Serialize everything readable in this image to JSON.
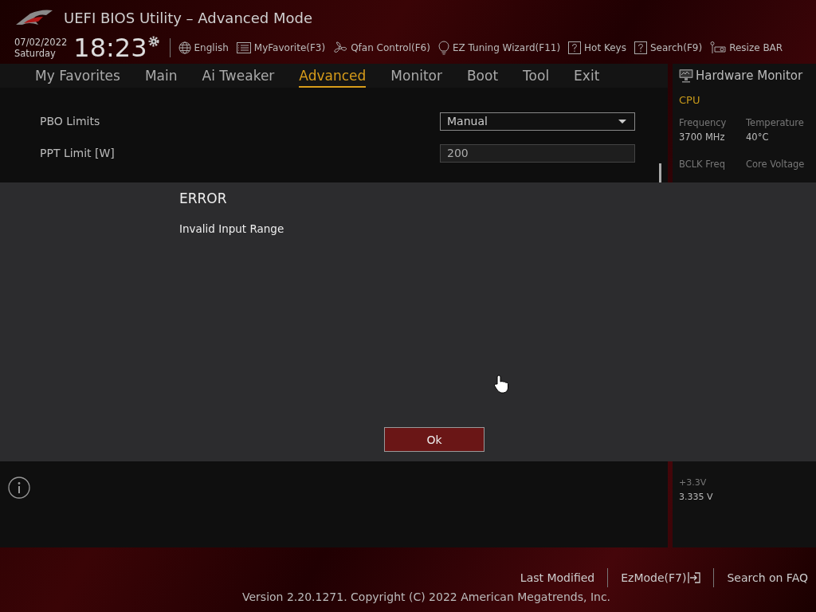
{
  "window": {
    "title": "UEFI BIOS Utility – Advanced Mode"
  },
  "clock": {
    "date": "07/02/2022",
    "day": "Saturday",
    "time": "18:23"
  },
  "toolbar": [
    {
      "label": "English",
      "kind": "globe"
    },
    {
      "label": "MyFavorite(F3)",
      "kind": "list"
    },
    {
      "label": "Qfan Control(F6)",
      "kind": "fan"
    },
    {
      "label": "EZ Tuning Wizard(F11)",
      "kind": "bulb"
    },
    {
      "label": "Hot Keys",
      "kind": "help"
    },
    {
      "label": "Search(F9)",
      "kind": "help"
    },
    {
      "label": "Resize BAR",
      "kind": "card"
    }
  ],
  "tabs": [
    {
      "label": "My Favorites",
      "selected": false
    },
    {
      "label": "Main",
      "selected": false
    },
    {
      "label": "Ai Tweaker",
      "selected": false
    },
    {
      "label": "Advanced",
      "selected": true
    },
    {
      "label": "Monitor",
      "selected": false
    },
    {
      "label": "Boot",
      "selected": false
    },
    {
      "label": "Tool",
      "selected": false
    },
    {
      "label": "Exit",
      "selected": false
    }
  ],
  "settings": [
    {
      "label": "PBO Limits",
      "kind": "dropdown",
      "value": "Manual"
    },
    {
      "label": "PPT Limit [W]",
      "kind": "input",
      "value": "200"
    }
  ],
  "hardware_monitor": {
    "title": "Hardware Monitor",
    "section": "CPU",
    "readings": [
      {
        "label": "Frequency",
        "value": "3700 MHz"
      },
      {
        "label": "Temperature",
        "value": "40°C"
      },
      {
        "label": "BCLK Freq"
      },
      {
        "label": "Core Voltage"
      }
    ],
    "voltages": [
      {
        "label": "+3.3V",
        "value": "3.335 V"
      }
    ]
  },
  "dialog": {
    "title": "ERROR",
    "message": "Invalid Input Range",
    "button": "Ok"
  },
  "footer": {
    "links": [
      {
        "label": "Last Modified",
        "kind": "text"
      },
      {
        "label": "EzMode(F7)",
        "kind": "exit"
      },
      {
        "label": "Search on FAQ",
        "kind": "text"
      }
    ],
    "version": "Version 2.20.1271. Copyright (C) 2022 American Megatrends, Inc."
  }
}
